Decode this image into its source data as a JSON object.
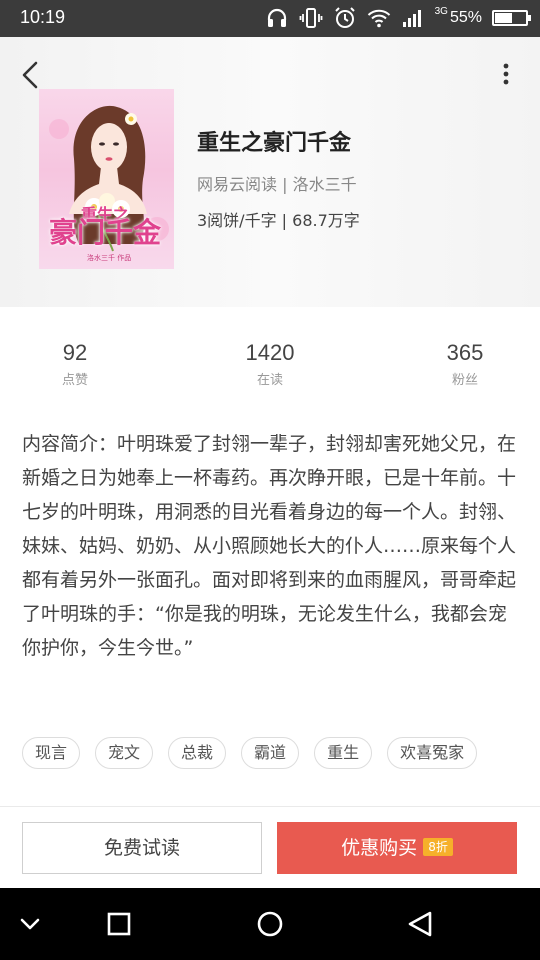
{
  "status_bar": {
    "time": "10:19",
    "network": "3G",
    "battery_percent_text": "55%",
    "battery_level": 0.55,
    "icons": [
      "headphones-icon",
      "vibrate-icon",
      "alarm-icon",
      "wifi-icon",
      "signal-icon",
      "battery-icon"
    ]
  },
  "header": {
    "back_icon": "chevron-left-icon",
    "more_icon": "more-vertical-icon"
  },
  "book": {
    "title": "重生之豪门千金",
    "meta": "网易云阅读 | 洛水三千",
    "price": "3阅饼/千字 | 68.7万字",
    "cover": {
      "title": "豪门千金",
      "subtitle": "重生之",
      "author_line": "洛水三千 作品"
    }
  },
  "stats": [
    {
      "value": "92",
      "label": "点赞"
    },
    {
      "value": "1420",
      "label": "在读"
    },
    {
      "value": "365",
      "label": "粉丝"
    }
  ],
  "description": "内容简介：叶明珠爱了封翎一辈子，封翎却害死她父兄，在新婚之日为她奉上一杯毒药。再次睁开眼，已是十年前。十七岁的叶明珠，用洞悉的目光看着身边的每一个人。封翎、妹妹、姑妈、奶奶、从小照顾她长大的仆人……原来每个人都有着另外一张面孔。面对即将到来的血雨腥风，哥哥牵起了叶明珠的手：“你是我的明珠，无论发生什么，我都会宠你护你，今生今世。”",
  "tags": [
    "现言",
    "宠文",
    "总裁",
    "霸道",
    "重生",
    "欢喜冤家"
  ],
  "actions": {
    "free_read": "免费试读",
    "buy": "优惠购买",
    "discount": "8折"
  },
  "colors": {
    "buy_button": "#e85a50",
    "discount_badge": "#f6b02a",
    "status_bar": "#3b3b3b"
  }
}
